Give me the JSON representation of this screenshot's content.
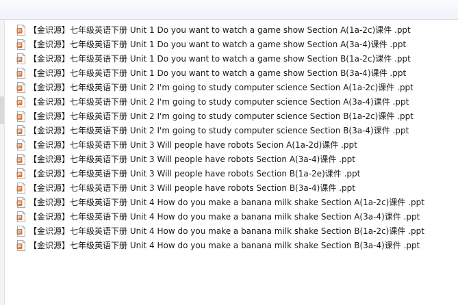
{
  "files": [
    {
      "name": "【金识源】七年级英语下册 Unit 1 Do you want to watch a game show Section A(1a-2c)课件 .ppt",
      "icon": "ppt-file-icon"
    },
    {
      "name": "【金识源】七年级英语下册 Unit 1 Do you want to watch a game show Section A(3a-4)课件 .ppt",
      "icon": "ppt-file-icon"
    },
    {
      "name": "【金识源】七年级英语下册 Unit 1 Do you want to watch a game show Section B(1a-2c)课件 .ppt",
      "icon": "ppt-file-icon"
    },
    {
      "name": "【金识源】七年级英语下册 Unit 1 Do you want to watch a game show Section B(3a-4)课件 .ppt",
      "icon": "ppt-file-icon"
    },
    {
      "name": "【金识源】七年级英语下册 Unit 2 I'm going to study computer science Section A(1a-2c)课件 .ppt",
      "icon": "ppt-file-icon"
    },
    {
      "name": "【金识源】七年级英语下册 Unit 2 I'm going to study computer science Section A(3a-4)课件 .ppt",
      "icon": "ppt-file-icon"
    },
    {
      "name": "【金识源】七年级英语下册 Unit 2 I'm going to study computer science Section B(1a-2c)课件 .ppt",
      "icon": "ppt-file-icon"
    },
    {
      "name": "【金识源】七年级英语下册 Unit 2 I'm going to study computer science Section B(3a-4)课件 .ppt",
      "icon": "ppt-file-icon"
    },
    {
      "name": "【金识源】七年级英语下册 Unit 3 Will people have robots Secion A(1a-2d)课件 .ppt",
      "icon": "ppt-file-icon"
    },
    {
      "name": "【金识源】七年级英语下册 Unit 3 Will people have robots Section A(3a-4)课件 .ppt",
      "icon": "ppt-file-icon"
    },
    {
      "name": "【金识源】七年级英语下册 Unit 3 Will people have robots Section B(1a-2e)课件 .ppt",
      "icon": "ppt-file-icon"
    },
    {
      "name": "【金识源】七年级英语下册 Unit 3 Will people have robots Section B(3a-4)课件 .ppt",
      "icon": "ppt-file-icon"
    },
    {
      "name": "【金识源】七年级英语下册 Unit 4 How do you make a banana milk shake Section A(1a-2c)课件 .ppt",
      "icon": "ppt-file-icon"
    },
    {
      "name": "【金识源】七年级英语下册 Unit 4 How do you make a banana milk shake Section A(3a-4)课件 .ppt",
      "icon": "ppt-file-icon"
    },
    {
      "name": "【金识源】七年级英语下册 Unit 4 How do you make a banana milk shake Section B(1a-2c)课件 .ppt",
      "icon": "ppt-file-icon"
    },
    {
      "name": "【金识源】七年级英语下册 Unit 4 How do you make a banana milk shake Section B(3a-4)课件 .ppt",
      "icon": "ppt-file-icon"
    }
  ],
  "colors": {
    "icon_accent": "#d9773b",
    "icon_border": "#a8a8a8"
  }
}
